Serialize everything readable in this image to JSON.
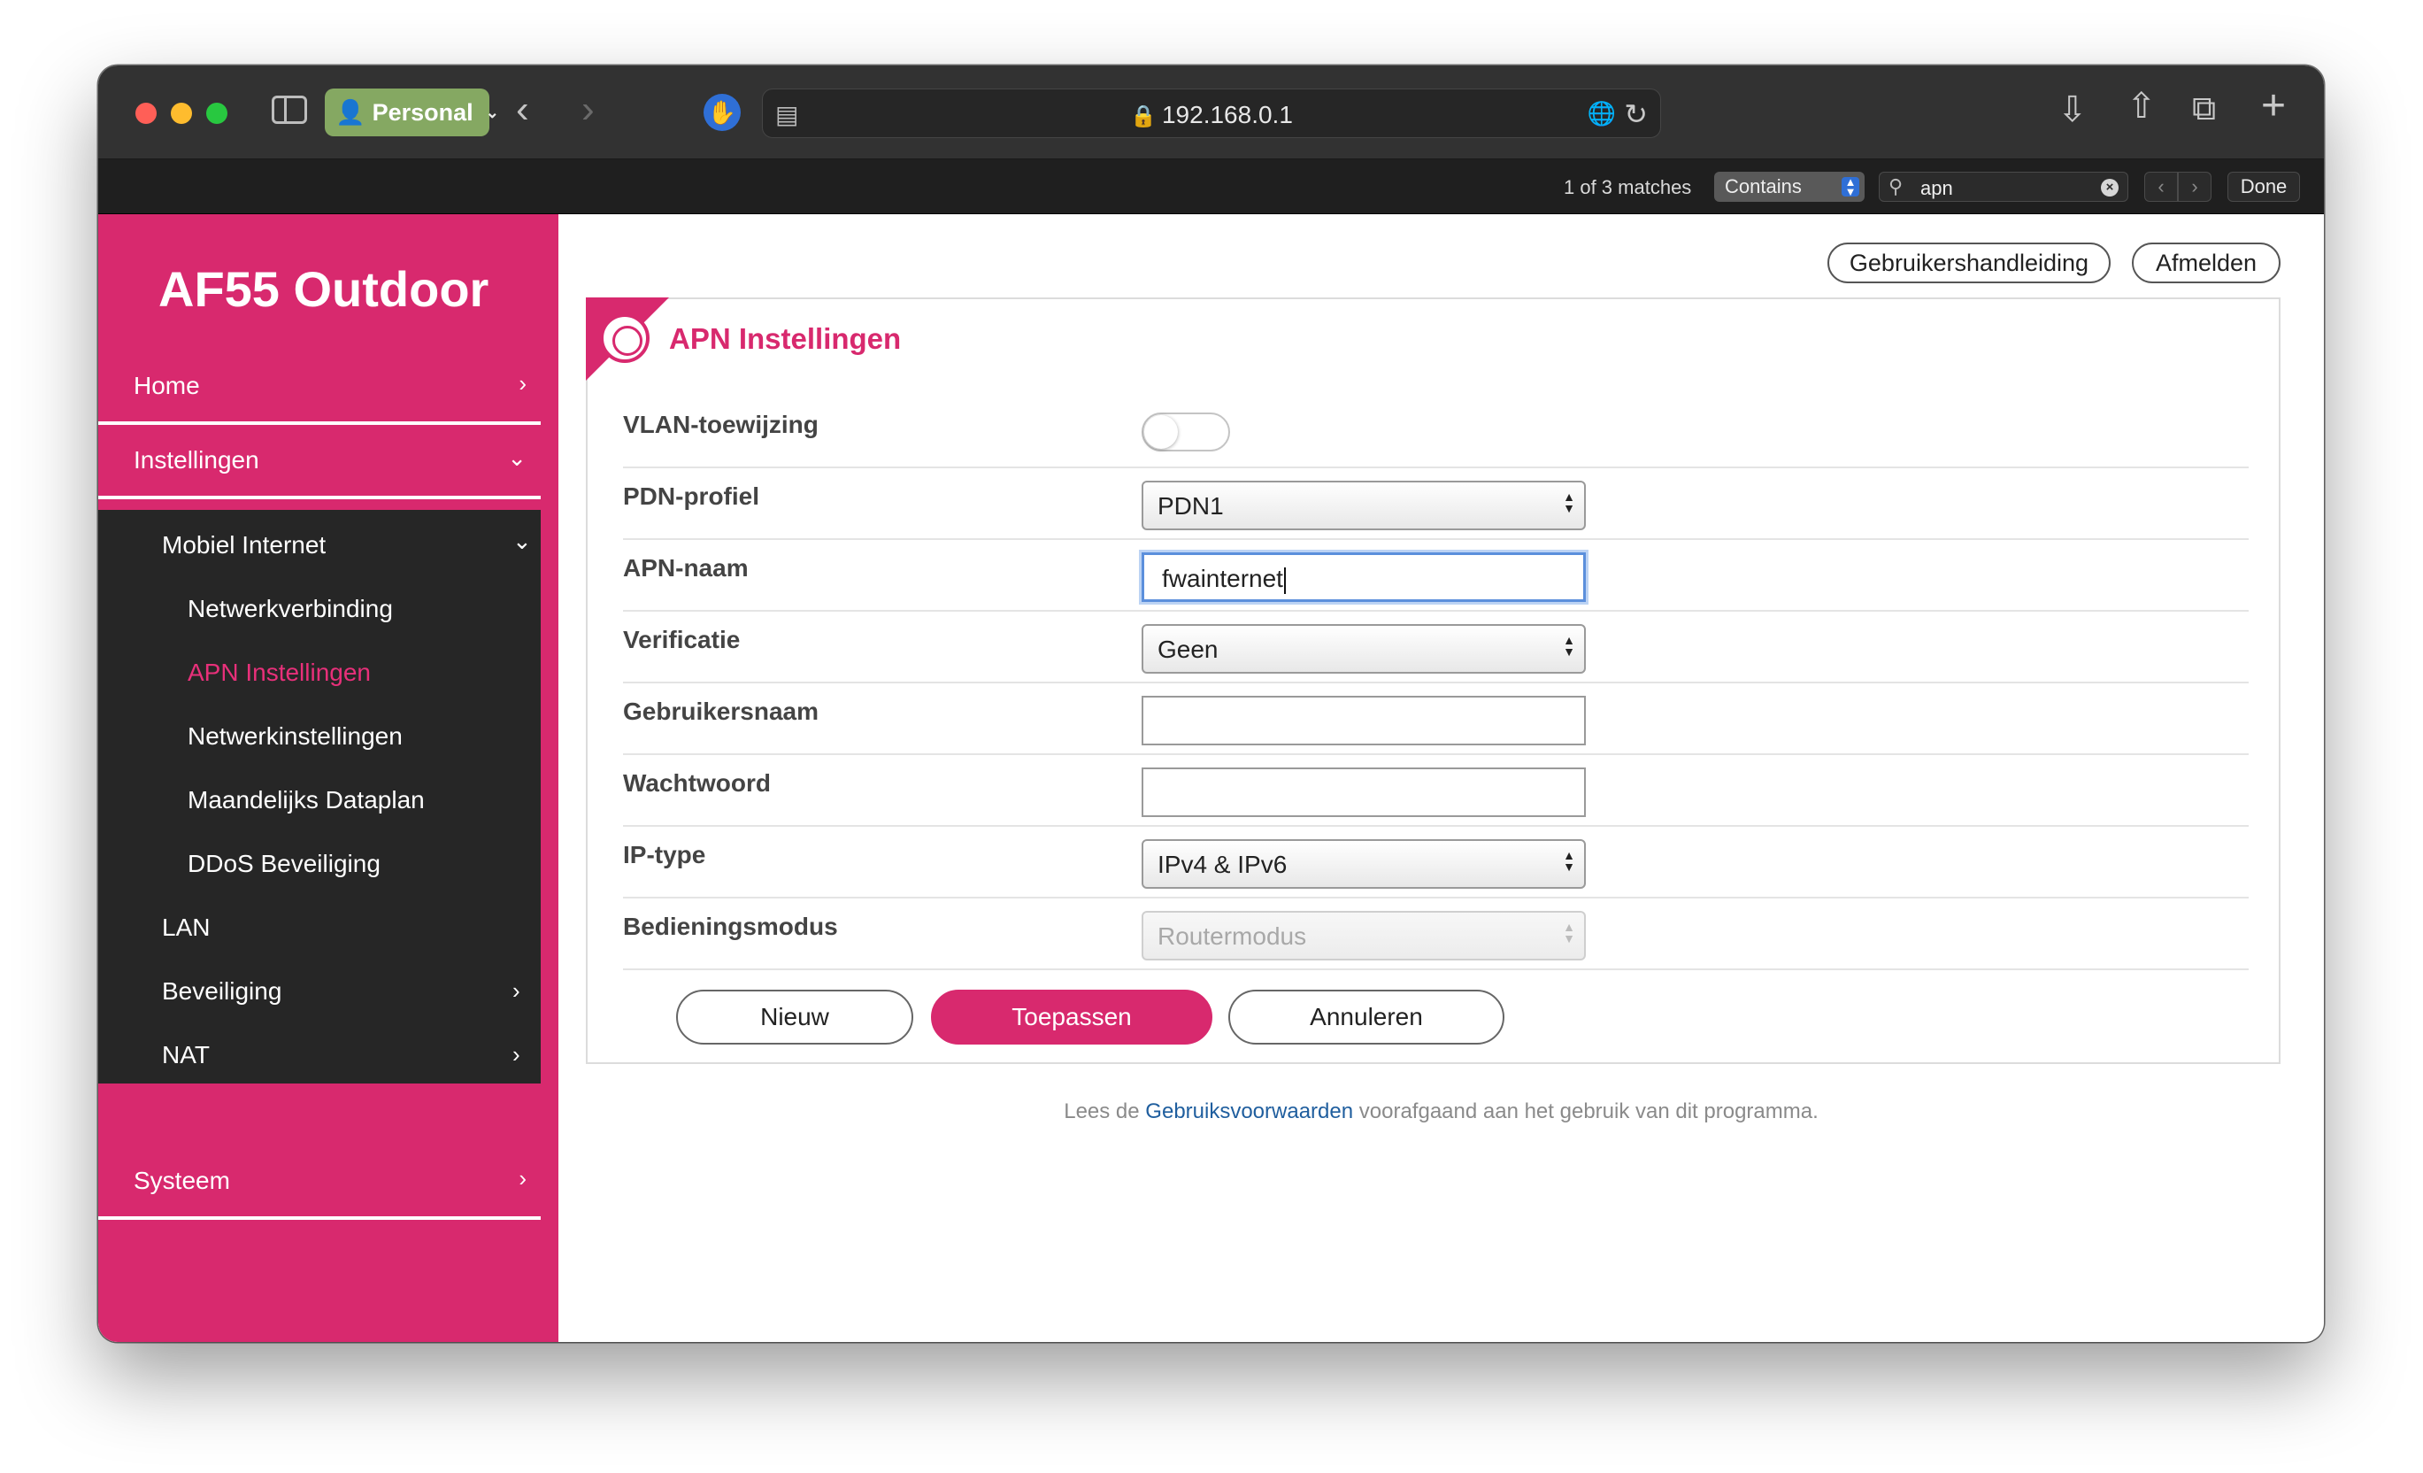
{
  "browser": {
    "profile": "Personal",
    "url": "192.168.0.1",
    "find": {
      "count": "1 of 3 matches",
      "mode": "Contains",
      "query": "apn",
      "done": "Done"
    }
  },
  "sidebar": {
    "brand": "AF55 Outdoor",
    "home": "Home",
    "settings": "Instellingen",
    "mobile_internet": "Mobiel Internet",
    "leaves": [
      "Netwerkverbinding",
      "APN Instellingen",
      "Netwerkinstellingen",
      "Maandelijks Dataplan",
      "DDoS Beveiliging"
    ],
    "lan": "LAN",
    "security": "Beveiliging",
    "nat": "NAT",
    "system": "Systeem"
  },
  "header": {
    "manual": "Gebruikershandleiding",
    "logout": "Afmelden"
  },
  "panel": {
    "title": "APN Instellingen",
    "fields": {
      "vlan": {
        "label": "VLAN-toewijzing",
        "enabled": false
      },
      "pdn": {
        "label": "PDN-profiel",
        "value": "PDN1"
      },
      "apn": {
        "label": "APN-naam",
        "value": "fwainternet"
      },
      "auth": {
        "label": "Verificatie",
        "value": "Geen"
      },
      "username": {
        "label": "Gebruikersnaam",
        "value": ""
      },
      "password": {
        "label": "Wachtwoord",
        "value": ""
      },
      "iptype": {
        "label": "IP-type",
        "value": "IPv4 & IPv6"
      },
      "mode": {
        "label": "Bedieningsmodus",
        "value": "Routermodus"
      }
    },
    "buttons": {
      "new": "Nieuw",
      "apply": "Toepassen",
      "cancel": "Annuleren"
    }
  },
  "footer": {
    "prefix": "Lees de",
    "link": "Gebruiksvoorwaarden",
    "suffix": "voorafgaand aan het gebruik van dit programma."
  },
  "colors": {
    "brand": "#d8296e",
    "sidebar_dark": "#262626",
    "link": "#1f5e9e"
  }
}
